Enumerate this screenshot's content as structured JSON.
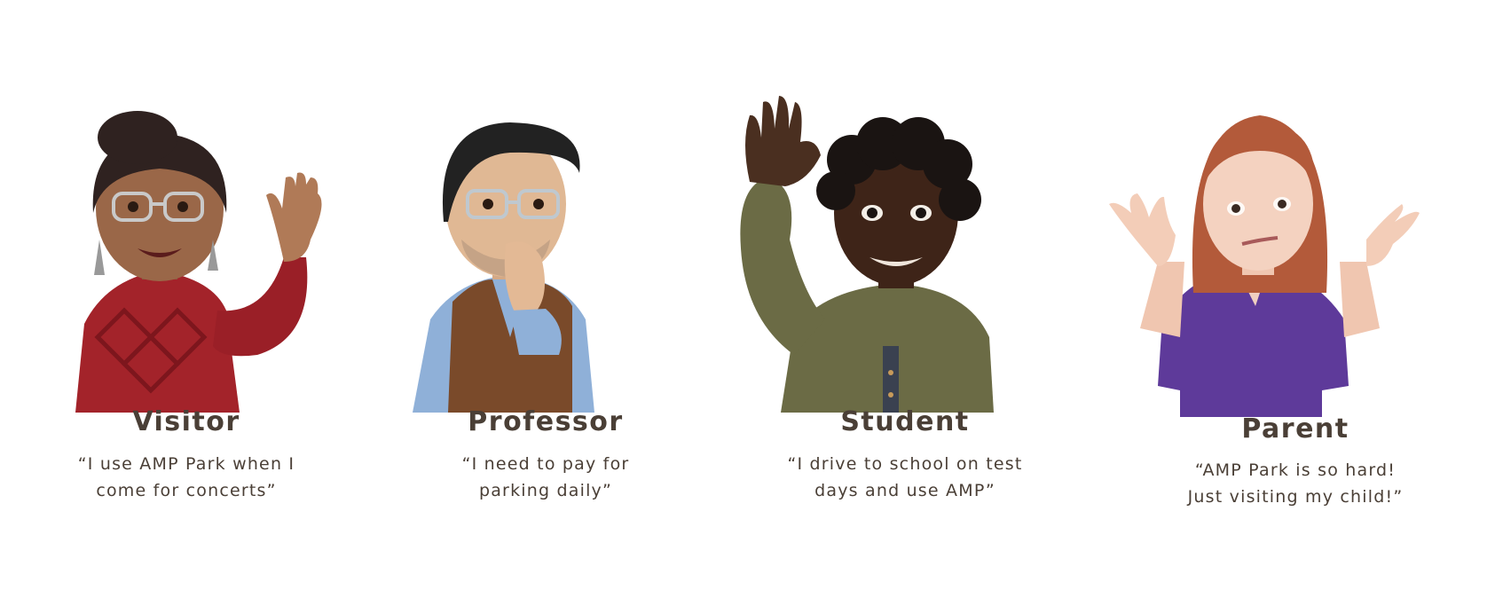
{
  "personas": [
    {
      "name": "Visitor",
      "quote": [
        "“I use AMP Park when I",
        "come for concerts”"
      ],
      "avatar_icon": "visitor-avatar-waving"
    },
    {
      "name": "Professor",
      "quote": [
        "“I need to pay for",
        "parking daily”"
      ],
      "avatar_icon": "professor-avatar-nervous"
    },
    {
      "name": "Student",
      "quote": [
        "“I drive to school on test",
        "days and use AMP”"
      ],
      "avatar_icon": "student-avatar-hand-raised"
    },
    {
      "name": "Parent",
      "quote": [
        "“AMP Park is so hard!",
        "Just visiting my child!”"
      ],
      "avatar_icon": "parent-avatar-shrugging"
    }
  ],
  "colors": {
    "text": "#4a3f36",
    "visitor_sweater": "#a3232a",
    "professor_shirt": "#8fb0d8",
    "professor_vest": "#7a4a2a",
    "student_hoodie": "#6b6b45",
    "parent_top": "#5e3a9a"
  }
}
